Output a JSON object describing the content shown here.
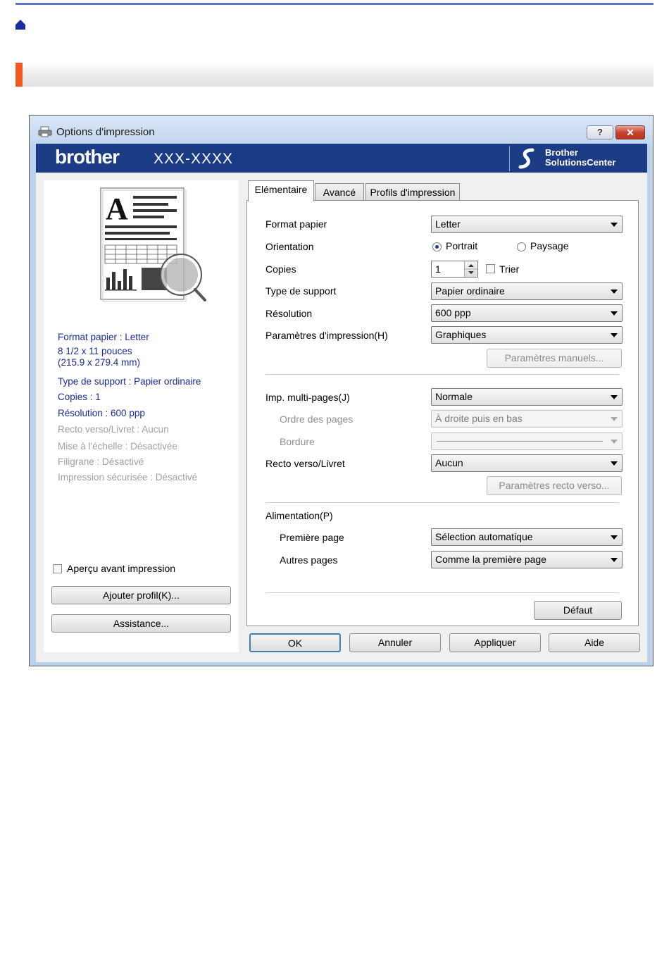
{
  "window": {
    "title": "Options d'impression",
    "help_label": "?",
    "close_label": "✕"
  },
  "banner": {
    "brand": "brother",
    "model": "XXX-XXXX",
    "solutions_line1": "Brother",
    "solutions_line2": "SolutionsCenter"
  },
  "preview": {
    "lines": [
      {
        "text": "Format papier : Letter",
        "state": "blue"
      },
      {
        "text": "8 1/2 x 11 pouces",
        "state": "blue"
      },
      {
        "text": "(215.9 x 279.4 mm)",
        "state": "blue"
      },
      {
        "text": "Type de support : Papier ordinaire",
        "state": "blue"
      },
      {
        "text": "Copies : 1",
        "state": "blue"
      },
      {
        "text": "Résolution : 600 ppp",
        "state": "blue"
      },
      {
        "text": "Recto verso/Livret : Aucun",
        "state": "gray"
      },
      {
        "text": "Mise à l'échelle : Désactivée",
        "state": "gray"
      },
      {
        "text": "Filigrane : Désactivé",
        "state": "gray"
      },
      {
        "text": "Impression sécurisée : Désactivé",
        "state": "gray"
      }
    ],
    "preview_checkbox": "Aperçu avant impression",
    "add_profile": "Ajouter profil(K)...",
    "assistance": "Assistance..."
  },
  "tabs": [
    "Elémentaire",
    "Avancé",
    "Profils d'impression"
  ],
  "basic": {
    "paper_size": {
      "label": "Format papier",
      "value": "Letter"
    },
    "orientation": {
      "label": "Orientation",
      "portrait": "Portrait",
      "landscape": "Paysage"
    },
    "copies": {
      "label": "Copies",
      "value": "1",
      "collate": "Trier"
    },
    "media_type": {
      "label": "Type de support",
      "value": "Papier ordinaire"
    },
    "resolution": {
      "label": "Résolution",
      "value": "600 ppp"
    },
    "print_settings": {
      "label": "Paramètres d'impression(H)",
      "value": "Graphiques"
    },
    "manual_settings": "Paramètres manuels...",
    "multi_page": {
      "label": "Imp. multi-pages(J)",
      "value": "Normale"
    },
    "page_order": {
      "label": "Ordre des pages",
      "value": "À droite puis en bas"
    },
    "border": {
      "label": "Bordure"
    },
    "duplex": {
      "label": "Recto verso/Livret",
      "value": "Aucun"
    },
    "duplex_settings": "Paramètres recto verso...",
    "paper_source": {
      "label": "Alimentation(P)"
    },
    "first_page": {
      "label": "Première page",
      "value": "Sélection automatique"
    },
    "other_pages": {
      "label": "Autres pages",
      "value": "Comme la première page"
    },
    "default": "Défaut"
  },
  "footer": {
    "ok": "OK",
    "cancel": "Annuler",
    "apply": "Appliquer",
    "help": "Aide"
  },
  "colors": {
    "accent_orange": "#f05a22",
    "banner_blue": "#1b3b85",
    "info_blue": "#1a2b9c"
  }
}
